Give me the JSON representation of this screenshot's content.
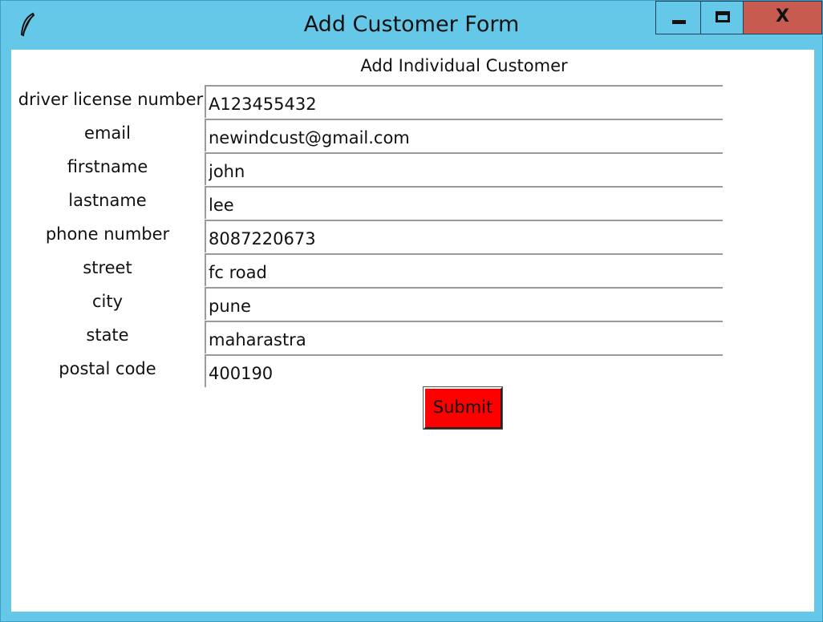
{
  "window": {
    "title": "Add Customer Form",
    "icon": "feather-icon",
    "controls": {
      "minimize": "minimize-icon",
      "maximize": "maximize-icon",
      "close_label": "X"
    }
  },
  "form": {
    "heading": "Add Individual Customer",
    "fields": [
      {
        "label": "driver license number",
        "value": "A123455432"
      },
      {
        "label": "email",
        "value": "newindcust@gmail.com"
      },
      {
        "label": "firstname",
        "value": "john"
      },
      {
        "label": "lastname",
        "value": "lee"
      },
      {
        "label": "phone number",
        "value": "8087220673"
      },
      {
        "label": "street",
        "value": "fc road"
      },
      {
        "label": "city",
        "value": "pune"
      },
      {
        "label": "state",
        "value": "maharastra"
      },
      {
        "label": "postal code",
        "value": "400190"
      }
    ],
    "submit_label": "Submit"
  },
  "colors": {
    "window_frame": "#66c8e8",
    "close_button": "#c75b50",
    "submit_button": "#ff0000"
  }
}
